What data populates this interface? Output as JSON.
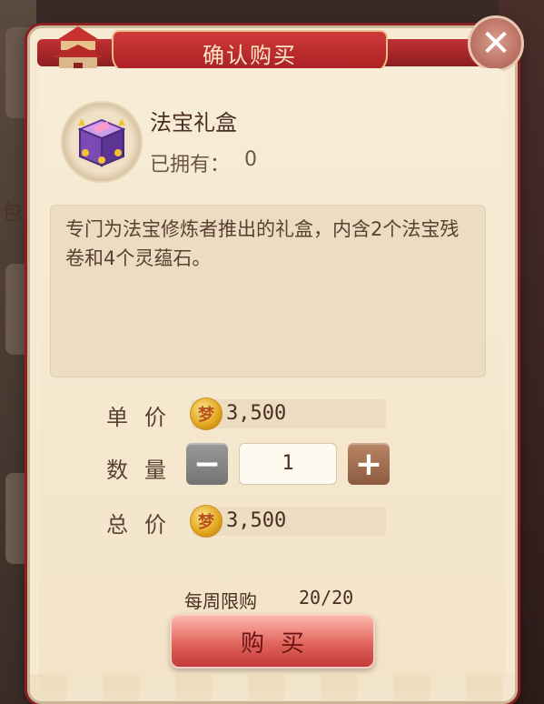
{
  "dialog": {
    "title": "确认购买",
    "close_glyph": "✕"
  },
  "background": {
    "left_label": "包"
  },
  "item": {
    "icon": "gift-box-icon",
    "name": "法宝礼盒",
    "owned_label": "已拥有：",
    "owned_value": "0"
  },
  "description": "专门为法宝修炼者推出的礼盒，内含2个法宝残卷和4个灵蕴石。",
  "unit_price": {
    "label": "单价",
    "value": "3,500",
    "currency_icon": "gold-coin-icon",
    "coin_glyph": "梦"
  },
  "quantity": {
    "label": "数量",
    "value": "1",
    "minus_glyph": "−",
    "plus_glyph": "+"
  },
  "total_price": {
    "label": "总价",
    "value": "3,500",
    "currency_icon": "gold-coin-icon",
    "coin_glyph": "梦"
  },
  "limit": {
    "label": "每周限购",
    "value": "20/20"
  },
  "buy_button": {
    "label": "购买"
  },
  "colors": {
    "title_red": "#a71e22",
    "panel": "#f6ead2",
    "buy_button": "#e0645d"
  }
}
